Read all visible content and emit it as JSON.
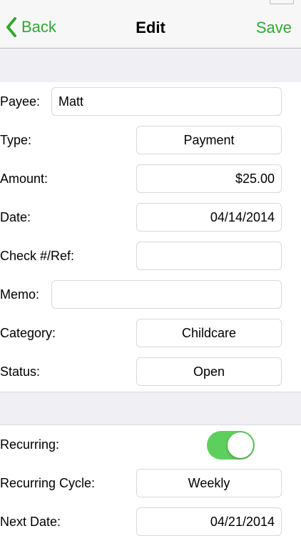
{
  "nav": {
    "back_label": "Back",
    "title": "Edit",
    "save_label": "Save"
  },
  "colors": {
    "accent": "#2eaa2e",
    "toggle_on": "#5ccf5c",
    "section_bg": "#efeff4"
  },
  "icons": {
    "back": "chevron-left-icon"
  },
  "form": {
    "payee": {
      "label": "Payee:",
      "value": "Matt"
    },
    "type": {
      "label": "Type:",
      "value": "Payment"
    },
    "amount": {
      "label": "Amount:",
      "value": "$25.00"
    },
    "date": {
      "label": "Date:",
      "value": "04/14/2014"
    },
    "check": {
      "label": "Check #/Ref:",
      "value": ""
    },
    "memo": {
      "label": "Memo:",
      "value": ""
    },
    "category": {
      "label": "Category:",
      "value": "Childcare"
    },
    "status": {
      "label": "Status:",
      "value": "Open"
    }
  },
  "recurring": {
    "toggle": {
      "label": "Recurring:",
      "on": true
    },
    "cycle": {
      "label": "Recurring Cycle:",
      "value": "Weekly"
    },
    "next_date": {
      "label": "Next Date:",
      "value": "04/21/2014"
    }
  }
}
